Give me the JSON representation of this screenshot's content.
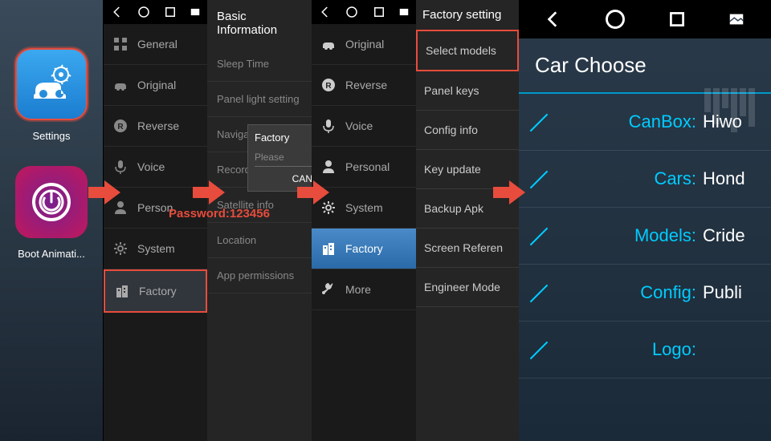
{
  "panel1": {
    "settings_label": "Settings",
    "boot_label": "Boot Animati..."
  },
  "panel2": {
    "items": [
      {
        "label": "General",
        "icon": "grid"
      },
      {
        "label": "Original",
        "icon": "car"
      },
      {
        "label": "Reverse",
        "icon": "reverse"
      },
      {
        "label": "Voice",
        "icon": "mic"
      },
      {
        "label": "Person",
        "icon": "person"
      },
      {
        "label": "System",
        "icon": "gear"
      },
      {
        "label": "Factory",
        "icon": "buildings"
      }
    ]
  },
  "panel3": {
    "title": "Basic Information",
    "items": [
      "Sleep Time",
      "Panel light setting",
      "Naviga",
      "Record",
      "Satellite info",
      "Location",
      "App permissions"
    ],
    "dialog_title": "Factory",
    "dialog_placeholder": "Please",
    "dialog_cancel": "CAN"
  },
  "password_hint": "Password:123456",
  "panel4": {
    "items": [
      {
        "label": "Original",
        "icon": "car"
      },
      {
        "label": "Reverse",
        "icon": "reverse"
      },
      {
        "label": "Voice",
        "icon": "mic"
      },
      {
        "label": "Personal",
        "icon": "person"
      },
      {
        "label": "System",
        "icon": "gear"
      },
      {
        "label": "Factory",
        "icon": "buildings",
        "selected": true
      },
      {
        "label": "More",
        "icon": "wrench"
      }
    ]
  },
  "panel5": {
    "title": "Factory setting",
    "items": [
      {
        "label": "Select models",
        "highlighted": true
      },
      {
        "label": "Panel keys"
      },
      {
        "label": "Config info"
      },
      {
        "label": "Key update"
      },
      {
        "label": "Backup Apk"
      },
      {
        "label": "Screen Referen"
      },
      {
        "label": "Engineer Mode"
      }
    ]
  },
  "panel6": {
    "title": "Car Choose",
    "rows": [
      {
        "label": "CanBox:",
        "value": "Hiwo"
      },
      {
        "label": "Cars:",
        "value": "Hond"
      },
      {
        "label": "Models:",
        "value": "Cride"
      },
      {
        "label": "Config:",
        "value": "Publi"
      },
      {
        "label": "Logo:",
        "value": ""
      }
    ]
  }
}
